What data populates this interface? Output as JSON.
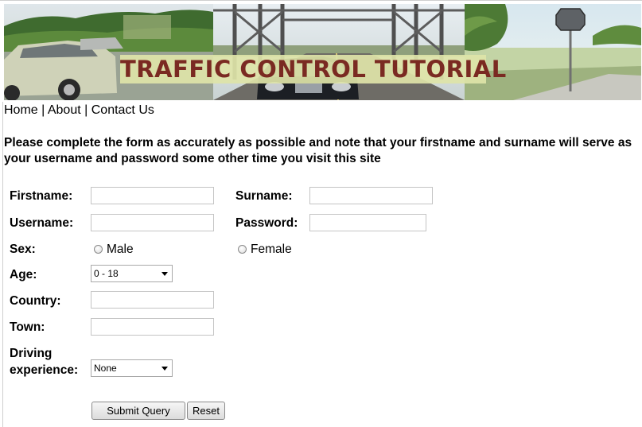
{
  "banner": {
    "title": "TRAFFIC CONTROL TUTORIAL"
  },
  "nav": {
    "home": "Home",
    "separator": "|",
    "about": "About",
    "contact": "Contact Us"
  },
  "intro": "Please complete the form as accurately as possible and note that your firstname and surname will serve as your username and password some other time you visit this site",
  "form": {
    "firstname_label": "Firstname:",
    "firstname_value": "",
    "surname_label": "Surname:",
    "surname_value": "",
    "username_label": "Username:",
    "username_value": "",
    "password_label": "Password:",
    "password_value": "",
    "sex_label": "Sex:",
    "sex_male": "Male",
    "sex_female": "Female",
    "age_label": "Age:",
    "age_selected": "0 - 18",
    "country_label": "Country:",
    "country_value": "",
    "town_label": "Town:",
    "town_value": "",
    "driving_label_line1": "Driving",
    "driving_label_line2": "experience:",
    "driving_selected": "None",
    "submit_label": "Submit Query",
    "reset_label": "Reset"
  },
  "colors": {
    "banner_title_text": "#7a2a22",
    "banner_title_band": "#dee4a8"
  },
  "icons": {
    "select_arrow": "chevron-down-icon"
  }
}
